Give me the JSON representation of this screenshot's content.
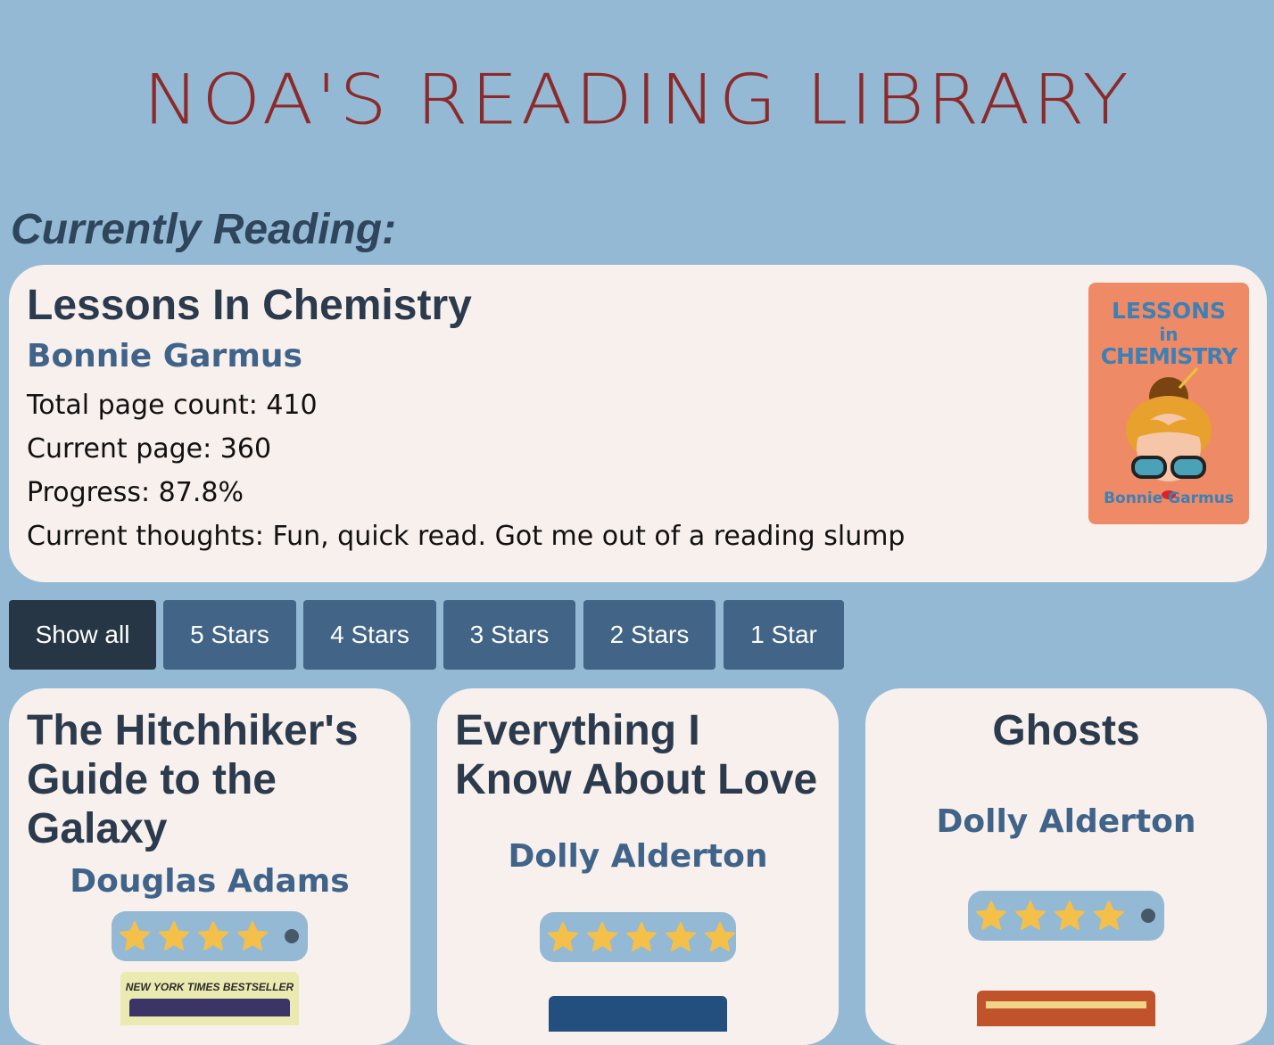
{
  "site": {
    "title": "NOA'S READING LIBRARY"
  },
  "currently_reading": {
    "heading": "Currently Reading:",
    "title": "Lessons In Chemistry",
    "author": "Bonnie Garmus",
    "total_pages_label": "Total page count: 410",
    "current_page_label": "Current page: 360",
    "progress_label": "Progress: 87.8%",
    "thoughts_label": "Current thoughts: Fun, quick read. Got me out of a reading slump",
    "cover": {
      "line1": "LESSONS",
      "line2": "in",
      "line3": "CHEMISTRY",
      "author": "Bonnie Garmus",
      "color": "#ef8a66"
    }
  },
  "filters": [
    {
      "label": "Show all",
      "active": true
    },
    {
      "label": "5 Stars",
      "active": false
    },
    {
      "label": "4 Stars",
      "active": false
    },
    {
      "label": "3 Stars",
      "active": false
    },
    {
      "label": "2 Stars",
      "active": false
    },
    {
      "label": "1 Star",
      "active": false
    }
  ],
  "books": [
    {
      "title": "The Hitchhiker's Guide to the Galaxy",
      "author": "Douglas Adams",
      "rating": 4,
      "cover_text": "NEW YORK TIMES BESTSELLER"
    },
    {
      "title": "Everything I Know About Love",
      "author": "Dolly Alderton",
      "rating": 5
    },
    {
      "title": "Ghosts",
      "author": "Dolly Alderton",
      "rating": 4
    }
  ],
  "colors": {
    "background": "#93b9d5",
    "card": "#f8f0ec",
    "title_red": "#8c2a2a",
    "button": "#416487",
    "button_active": "#263644",
    "star": "#f5c04a"
  }
}
